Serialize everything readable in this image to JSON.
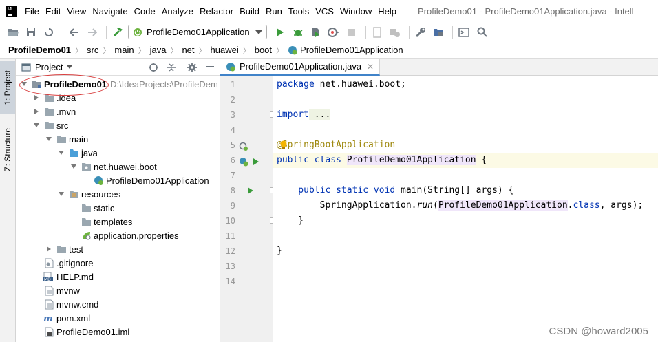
{
  "menu": {
    "items": [
      "File",
      "Edit",
      "View",
      "Navigate",
      "Code",
      "Analyze",
      "Refactor",
      "Build",
      "Run",
      "Tools",
      "VCS",
      "Window",
      "Help"
    ],
    "window_title": "ProfileDemo01 - ProfileDemo01Application.java - Intell"
  },
  "toolbar": {
    "run_config": "ProfileDemo01Application",
    "icons": [
      "open-folder-icon",
      "save-icon",
      "sync-icon",
      "back-arrow-icon",
      "forward-arrow-icon",
      "build-hammer-icon",
      "run-icon",
      "debug-icon",
      "coverage-icon",
      "profile-icon",
      "stop-icon",
      "rerun-icon",
      "tasks-icon",
      "settings-wrench-icon",
      "project-structure-icon",
      "terminal-icon",
      "search-icon"
    ]
  },
  "breadcrumb": [
    "ProfileDemo01",
    "src",
    "main",
    "java",
    "net",
    "huawei",
    "boot",
    "ProfileDemo01Application"
  ],
  "tool_strip": {
    "project_tab": "1: Project",
    "structure_tab": "Z: Structure"
  },
  "project_panel": {
    "title": "Project",
    "tree": [
      {
        "label": "ProfileDemo01",
        "path": "D:\\IdeaProjects\\ProfileDem",
        "icon": "module-icon",
        "level": 0,
        "arrow": "down",
        "bold": true
      },
      {
        "label": ".idea",
        "icon": "folder-icon",
        "level": 1,
        "arrow": "right"
      },
      {
        "label": ".mvn",
        "icon": "folder-icon",
        "level": 1,
        "arrow": "right"
      },
      {
        "label": "src",
        "icon": "folder-icon",
        "level": 1,
        "arrow": "down"
      },
      {
        "label": "main",
        "icon": "folder-icon",
        "level": 2,
        "arrow": "down"
      },
      {
        "label": "java",
        "icon": "source-folder-icon",
        "level": 3,
        "arrow": "down"
      },
      {
        "label": "net.huawei.boot",
        "icon": "package-icon",
        "level": 4,
        "arrow": "down"
      },
      {
        "label": "ProfileDemo01Application",
        "icon": "spring-class-icon",
        "level": 5,
        "arrow": "none"
      },
      {
        "label": "resources",
        "icon": "resources-folder-icon",
        "level": 3,
        "arrow": "down"
      },
      {
        "label": "static",
        "icon": "folder-icon",
        "level": 4,
        "arrow": "none"
      },
      {
        "label": "templates",
        "icon": "folder-icon",
        "level": 4,
        "arrow": "none"
      },
      {
        "label": "application.properties",
        "icon": "spring-properties-icon",
        "level": 4,
        "arrow": "none"
      },
      {
        "label": "test",
        "icon": "folder-icon",
        "level": 2,
        "arrow": "right"
      },
      {
        "label": ".gitignore",
        "icon": "gitignore-file-icon",
        "level": 1,
        "arrow": "none"
      },
      {
        "label": "HELP.md",
        "icon": "markdown-file-icon",
        "level": 1,
        "arrow": "none"
      },
      {
        "label": "mvnw",
        "icon": "text-file-icon",
        "level": 1,
        "arrow": "none"
      },
      {
        "label": "mvnw.cmd",
        "icon": "text-file-icon",
        "level": 1,
        "arrow": "none"
      },
      {
        "label": "pom.xml",
        "icon": "maven-icon",
        "level": 1,
        "arrow": "none"
      },
      {
        "label": "ProfileDemo01.iml",
        "icon": "iml-file-icon",
        "level": 1,
        "arrow": "none"
      }
    ]
  },
  "editor": {
    "tab_label": "ProfileDemo01Application.java",
    "line_numbers": [
      "1",
      "2",
      "3",
      "4",
      "5",
      "6",
      "7",
      "8",
      "9",
      "10",
      "11",
      "12",
      "13",
      "14"
    ],
    "code": {
      "l1_kw": "package",
      "l1_rest": " net.huawei.boot;",
      "l3_kw": "import",
      "l3_rest": " ...",
      "l6_at": "@",
      "l6_anno": "SpringBootApplication",
      "l7_kw": "public class",
      "l7_cls": "ProfileDemo01Application",
      "l7_rest": " {",
      "l9_kw": "    public static void",
      "l9_rest": " main(String[] args) {",
      "l10_a": "        SpringApplication.",
      "l10_run": "run",
      "l10_b": "(",
      "l10_cls": "ProfileDemo01Application",
      "l10_c": ".",
      "l10_kw": "class",
      "l10_d": ", args);",
      "l11": "    }",
      "l13": "}"
    }
  },
  "watermark": "CSDN @howard2005",
  "colors": {
    "keyword": "#0033b3",
    "annotation": "#9e880d",
    "run_green": "#3a9b3a",
    "spring_green": "#6db33f",
    "folder_gray": "#9aa7b0",
    "source_blue": "#4a9fd8",
    "annotation_circle": "#d94040"
  }
}
